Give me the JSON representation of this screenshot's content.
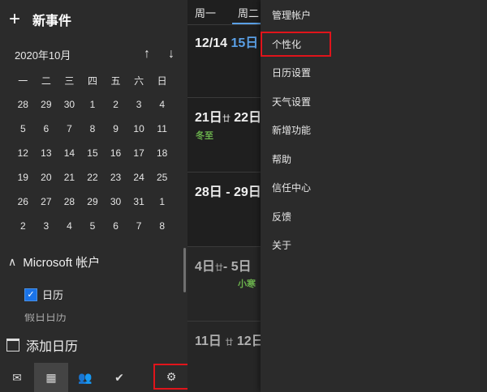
{
  "sidebar": {
    "new_event": "新事件",
    "month": "2020年10月",
    "weekdays": [
      "一",
      "二",
      "三",
      "四",
      "五",
      "六",
      "日"
    ],
    "weeks": [
      [
        "28",
        "29",
        "30",
        "1",
        "2",
        "3",
        "4"
      ],
      [
        "5",
        "6",
        "7",
        "8",
        "9",
        "10",
        "11"
      ],
      [
        "12",
        "13",
        "14",
        "15",
        "16",
        "17",
        "18"
      ],
      [
        "19",
        "20",
        "21",
        "22",
        "23",
        "24",
        "25"
      ],
      [
        "26",
        "27",
        "28",
        "29",
        "30",
        "31",
        "1"
      ],
      [
        "2",
        "3",
        "4",
        "5",
        "6",
        "7",
        "8"
      ]
    ],
    "account": "Microsoft 帐户",
    "calendar_item": "日历",
    "partial_item": "假日日历",
    "add_calendar": "添加日历"
  },
  "calendar": {
    "day_headers": [
      "周一",
      "周二"
    ],
    "weeks": [
      {
        "a": "12/14",
        "b": "15日"
      },
      {
        "a": "21日",
        "a2": "廿",
        "b": "22日",
        "fest": "冬至"
      },
      {
        "a": "28日",
        "b": "29日"
      },
      {
        "a": "4日",
        "a2": "廿",
        "b": "5日",
        "fest": "小寒"
      },
      {
        "a": "11日",
        "a2": "廿",
        "b": "12日"
      }
    ]
  },
  "menu": {
    "items": [
      "管理帐户",
      "个性化",
      "日历设置",
      "天气设置",
      "新增功能",
      "帮助",
      "信任中心",
      "反馈",
      "关于"
    ]
  },
  "colors": {
    "accent": "#5aa0e6",
    "festival": "#6ab04c",
    "highlight_box": "#e0141b"
  }
}
